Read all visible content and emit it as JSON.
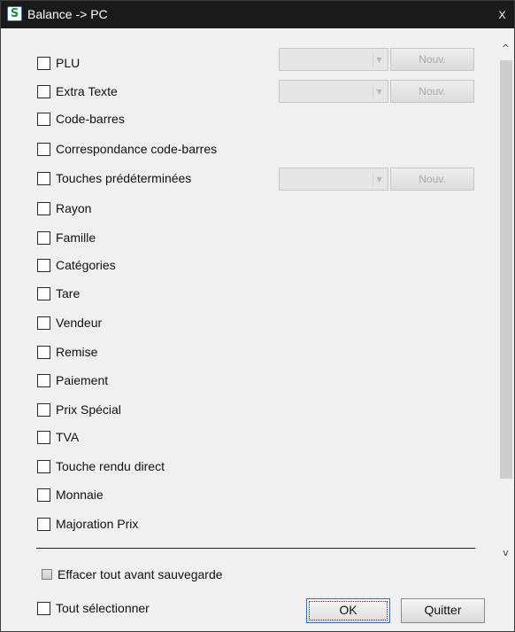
{
  "window": {
    "title": "Balance -> PC",
    "close_label": "x",
    "icon_glyph": "S"
  },
  "options": [
    {
      "label": "PLU",
      "checked": false,
      "has_combo": true
    },
    {
      "label": "Extra Texte",
      "checked": false,
      "has_combo": true
    },
    {
      "label": "Code-barres",
      "checked": false
    },
    {
      "label": "Correspondance code-barres",
      "checked": false
    },
    {
      "label": "Touches prédéterminées",
      "checked": false,
      "has_combo": true
    },
    {
      "label": "Rayon",
      "checked": false
    },
    {
      "label": "Famille",
      "checked": false
    },
    {
      "label": "Catégories",
      "checked": false
    },
    {
      "label": "Tare",
      "checked": false
    },
    {
      "label": "Vendeur",
      "checked": false
    },
    {
      "label": "Remise",
      "checked": false
    },
    {
      "label": "Paiement",
      "checked": false
    },
    {
      "label": "Prix Spécial",
      "checked": false
    },
    {
      "label": "TVA",
      "checked": false
    },
    {
      "label": "Touche rendu direct",
      "checked": false
    },
    {
      "label": "Monnaie",
      "checked": false
    },
    {
      "label": "Majoration Prix",
      "checked": false
    }
  ],
  "new_button_label": "Nouv.",
  "combo_arrow_glyph": "▼",
  "scroll": {
    "up_glyph": "^",
    "down_glyph": "v"
  },
  "footer": {
    "clear_before_save_label": "Effacer tout avant sauvegarde",
    "select_all_label": "Tout sélectionner",
    "ok_label": "OK",
    "quit_label": "Quitter"
  }
}
